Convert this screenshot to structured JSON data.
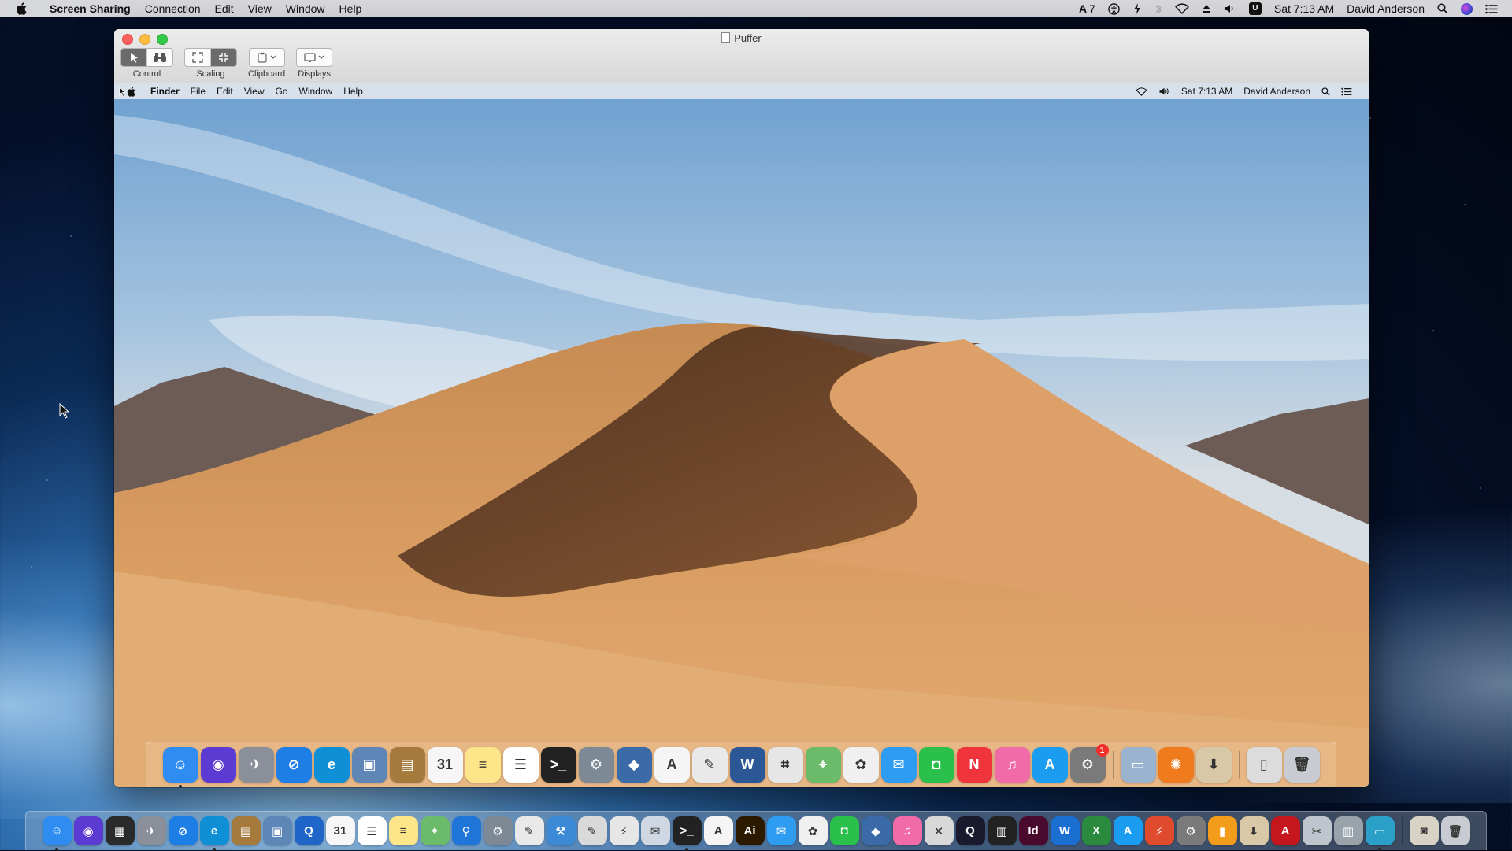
{
  "host_menubar": {
    "app": "Screen Sharing",
    "menus": [
      "Connection",
      "Edit",
      "View",
      "Window",
      "Help"
    ],
    "status": {
      "input_badge": "7",
      "clock": "Sat 7:13 AM",
      "user": "David Anderson"
    }
  },
  "window": {
    "title": "Puffer",
    "toolbar": {
      "control_label": "Control",
      "scaling_label": "Scaling",
      "clipboard_label": "Clipboard",
      "displays_label": "Displays"
    }
  },
  "remote_menubar": {
    "app": "Finder",
    "menus": [
      "File",
      "Edit",
      "View",
      "Go",
      "Window",
      "Help"
    ],
    "clock": "Sat 7:13 AM",
    "user": "David Anderson"
  },
  "remote_dock": {
    "items": [
      {
        "name": "finder",
        "label": "☺",
        "color": "#2f8df2",
        "running": true
      },
      {
        "name": "siri",
        "label": "◉",
        "color": "#5b3bd1"
      },
      {
        "name": "launchpad",
        "label": "✈",
        "color": "#8a8f99"
      },
      {
        "name": "safari",
        "label": "⊘",
        "color": "#1d7ee5"
      },
      {
        "name": "edge",
        "label": "e",
        "color": "#0f8fd6"
      },
      {
        "name": "preview",
        "label": "▣",
        "color": "#5e87b8"
      },
      {
        "name": "notefile",
        "label": "▤",
        "color": "#a57a3c"
      },
      {
        "name": "calendar",
        "label": "31",
        "color": "#f6f6f6",
        "dark": true
      },
      {
        "name": "notes",
        "label": "≡",
        "color": "#fde58a",
        "dark": true
      },
      {
        "name": "reminders",
        "label": "☰",
        "color": "#ffffff",
        "dark": true
      },
      {
        "name": "terminal",
        "label": ">_",
        "color": "#222222"
      },
      {
        "name": "utility",
        "label": "⚙",
        "color": "#7d8a96"
      },
      {
        "name": "virtualbox",
        "label": "◆",
        "color": "#3a6aa8"
      },
      {
        "name": "acrobat",
        "label": "A",
        "color": "#f5f5f5",
        "dark": true
      },
      {
        "name": "textedit",
        "label": "✎",
        "color": "#e9e9e9",
        "dark": true
      },
      {
        "name": "word",
        "label": "W",
        "color": "#2b5797"
      },
      {
        "name": "screenshot",
        "label": "⌗",
        "color": "#e6e6e6",
        "dark": true
      },
      {
        "name": "maps",
        "label": "⌖",
        "color": "#6bbb6b"
      },
      {
        "name": "photos",
        "label": "✿",
        "color": "#f0f0f0",
        "dark": true
      },
      {
        "name": "messages",
        "label": "✉",
        "color": "#2e9cf0"
      },
      {
        "name": "facetime",
        "label": "◘",
        "color": "#2bbf4b"
      },
      {
        "name": "news",
        "label": "N",
        "color": "#f0343c"
      },
      {
        "name": "itunes",
        "label": "♫",
        "color": "#f16ba8"
      },
      {
        "name": "app-store",
        "label": "A",
        "color": "#1a9df0"
      },
      {
        "name": "system-preferences",
        "label": "⚙",
        "color": "#7a7a7a",
        "badge": "1"
      },
      {
        "name": "screen-sharing",
        "label": "▭",
        "color": "#9ab4d0",
        "sep_before": true
      },
      {
        "name": "firefox",
        "label": "✺",
        "color": "#f07b1d"
      },
      {
        "name": "installer",
        "label": "⬇",
        "color": "#d8c8a8",
        "dark": true
      },
      {
        "name": "documents",
        "label": "▯",
        "color": "#dcdcdc",
        "dark": true,
        "sep_before": true
      },
      {
        "name": "trash",
        "label": "🗑",
        "color": "#c8ccd2",
        "dark": true
      }
    ]
  },
  "host_dock": {
    "items": [
      {
        "name": "finder",
        "label": "☺",
        "color": "#2f8df2",
        "running": true
      },
      {
        "name": "siri",
        "label": "◉",
        "color": "#5b3bd1"
      },
      {
        "name": "windows",
        "label": "▦",
        "color": "#2a2a2a"
      },
      {
        "name": "launchpad",
        "label": "✈",
        "color": "#8a8f99"
      },
      {
        "name": "safari",
        "label": "⊘",
        "color": "#1d7ee5"
      },
      {
        "name": "edge",
        "label": "e",
        "color": "#0f8fd6",
        "running": true
      },
      {
        "name": "notefile",
        "label": "▤",
        "color": "#a57a3c"
      },
      {
        "name": "preview",
        "label": "▣",
        "color": "#5e87b8"
      },
      {
        "name": "quicklook",
        "label": "Q",
        "color": "#2066c8"
      },
      {
        "name": "calendar",
        "label": "31",
        "color": "#f6f6f6",
        "dark": true
      },
      {
        "name": "reminders",
        "label": "☰",
        "color": "#ffffff",
        "dark": true
      },
      {
        "name": "notes",
        "label": "≡",
        "color": "#fde58a",
        "dark": true
      },
      {
        "name": "maps",
        "label": "⌖",
        "color": "#6bbb6b"
      },
      {
        "name": "location",
        "label": "⚲",
        "color": "#1f76d8"
      },
      {
        "name": "utility",
        "label": "⚙",
        "color": "#7d8a96"
      },
      {
        "name": "textedit",
        "label": "✎",
        "color": "#e9e9e9",
        "dark": true
      },
      {
        "name": "xcode",
        "label": "⚒",
        "color": "#3c8ad6"
      },
      {
        "name": "pages",
        "label": "✎",
        "color": "#d9d9d9",
        "dark": true
      },
      {
        "name": "tool",
        "label": "⚡",
        "color": "#e6e6e6",
        "dark": true
      },
      {
        "name": "mail",
        "label": "✉",
        "color": "#cfd8e2",
        "dark": true
      },
      {
        "name": "terminal",
        "label": ">_",
        "color": "#222222",
        "running": true
      },
      {
        "name": "acrobat",
        "label": "A",
        "color": "#f5f5f5",
        "dark": true
      },
      {
        "name": "illustrator",
        "label": "Ai",
        "color": "#2b1a00"
      },
      {
        "name": "messages",
        "label": "✉",
        "color": "#2e9cf0"
      },
      {
        "name": "photos",
        "label": "✿",
        "color": "#f0f0f0",
        "dark": true
      },
      {
        "name": "facetime",
        "label": "◘",
        "color": "#2bbf4b"
      },
      {
        "name": "virtualbox",
        "label": "◆",
        "color": "#3a6aa8"
      },
      {
        "name": "itunes",
        "label": "♫",
        "color": "#f16ba8"
      },
      {
        "name": "network",
        "label": "✕",
        "color": "#d8d8d8",
        "dark": true
      },
      {
        "name": "quicktime",
        "label": "Q",
        "color": "#1a1a2e"
      },
      {
        "name": "piano",
        "label": "▥",
        "color": "#222222"
      },
      {
        "name": "indesign",
        "label": "Id",
        "color": "#4a0a2e"
      },
      {
        "name": "word-alt",
        "label": "W",
        "color": "#1a6fd1"
      },
      {
        "name": "excel",
        "label": "X",
        "color": "#2a8a3e"
      },
      {
        "name": "app-store",
        "label": "A",
        "color": "#1a9df0"
      },
      {
        "name": "remote-desktop",
        "label": "⚡",
        "color": "#e04b2e"
      },
      {
        "name": "system-preferences",
        "label": "⚙",
        "color": "#7a7a7a"
      },
      {
        "name": "books",
        "label": "▮",
        "color": "#f39b1a"
      },
      {
        "name": "installer",
        "label": "⬇",
        "color": "#d8c8a8",
        "dark": true
      },
      {
        "name": "acrobat-pro",
        "label": "A",
        "color": "#c4161c"
      },
      {
        "name": "tools",
        "label": "✂",
        "color": "#bfc5cc",
        "dark": true
      },
      {
        "name": "archive",
        "label": "▥",
        "color": "#9aa2aa"
      },
      {
        "name": "screen-sharing",
        "label": "▭",
        "color": "#2aa0c8",
        "running": true
      },
      {
        "name": "photo-booth",
        "label": "◙",
        "color": "#d8d2c4",
        "dark": true,
        "sep_before": true
      },
      {
        "name": "trash",
        "label": "🗑",
        "color": "#c8ccd2",
        "dark": true
      }
    ]
  }
}
